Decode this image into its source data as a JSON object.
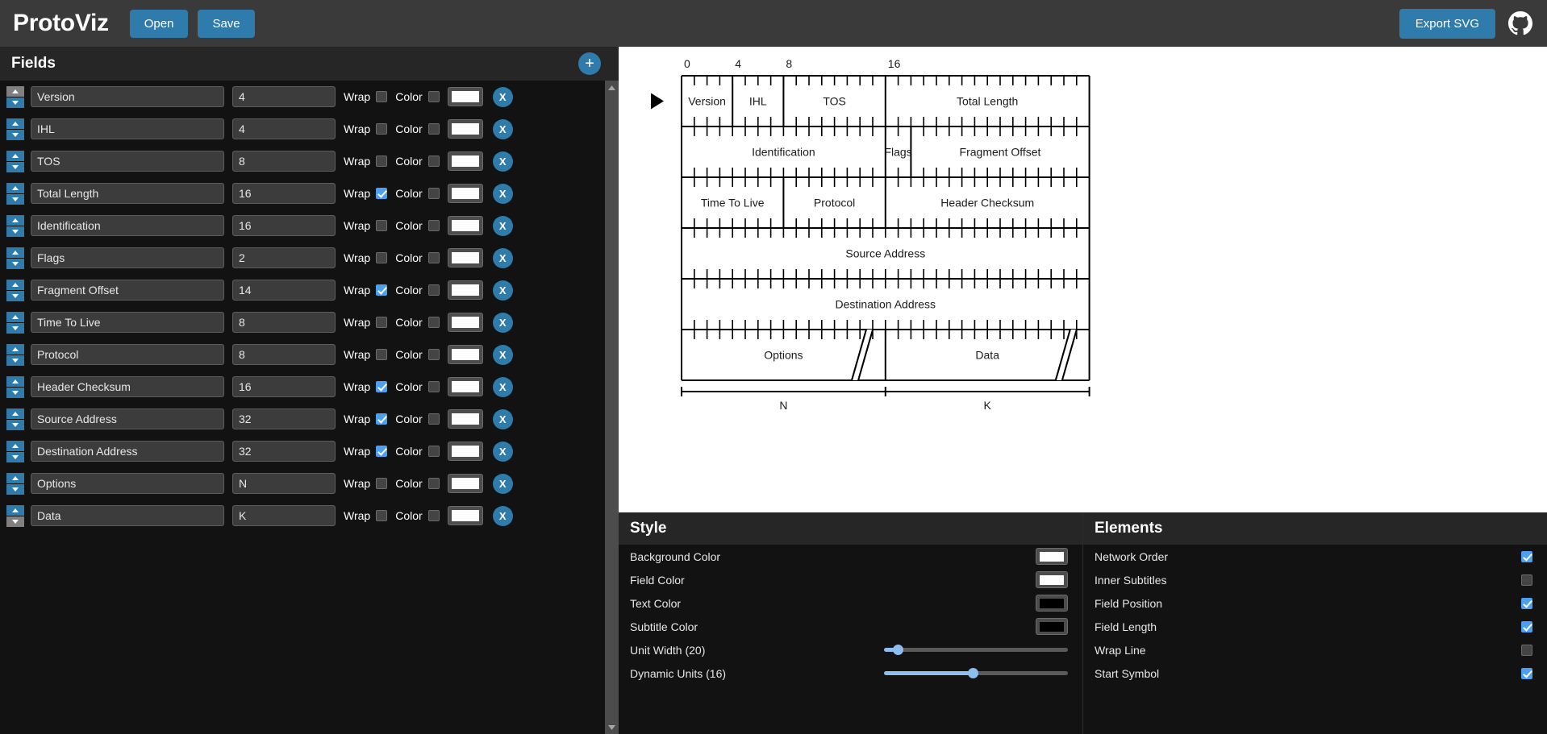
{
  "app": {
    "title": "ProtoViz",
    "open_label": "Open",
    "save_label": "Save",
    "export_label": "Export SVG",
    "github_icon": "github-icon"
  },
  "fields_panel": {
    "title": "Fields",
    "add_label": "+",
    "wrap_label": "Wrap",
    "color_label": "Color",
    "delete_label": "X",
    "rows": [
      {
        "name": "Version",
        "size": "4",
        "wrap": false,
        "color": false,
        "swatch": "#ffffff"
      },
      {
        "name": "IHL",
        "size": "4",
        "wrap": false,
        "color": false,
        "swatch": "#ffffff"
      },
      {
        "name": "TOS",
        "size": "8",
        "wrap": false,
        "color": false,
        "swatch": "#ffffff"
      },
      {
        "name": "Total Length",
        "size": "16",
        "wrap": true,
        "color": false,
        "swatch": "#ffffff"
      },
      {
        "name": "Identification",
        "size": "16",
        "wrap": false,
        "color": false,
        "swatch": "#ffffff"
      },
      {
        "name": "Flags",
        "size": "2",
        "wrap": false,
        "color": false,
        "swatch": "#ffffff"
      },
      {
        "name": "Fragment Offset",
        "size": "14",
        "wrap": true,
        "color": false,
        "swatch": "#ffffff"
      },
      {
        "name": "Time To Live",
        "size": "8",
        "wrap": false,
        "color": false,
        "swatch": "#ffffff"
      },
      {
        "name": "Protocol",
        "size": "8",
        "wrap": false,
        "color": false,
        "swatch": "#ffffff"
      },
      {
        "name": "Header Checksum",
        "size": "16",
        "wrap": true,
        "color": false,
        "swatch": "#ffffff"
      },
      {
        "name": "Source Address",
        "size": "32",
        "wrap": true,
        "color": false,
        "swatch": "#ffffff"
      },
      {
        "name": "Destination Address",
        "size": "32",
        "wrap": true,
        "color": false,
        "swatch": "#ffffff"
      },
      {
        "name": "Options",
        "size": "N",
        "wrap": false,
        "color": false,
        "swatch": "#ffffff"
      },
      {
        "name": "Data",
        "size": "K",
        "wrap": false,
        "color": false,
        "swatch": "#ffffff"
      }
    ]
  },
  "style_panel": {
    "title": "Style",
    "options": [
      {
        "label": "Background Color",
        "type": "color",
        "value": "#ffffff"
      },
      {
        "label": "Field Color",
        "type": "color",
        "value": "#ffffff"
      },
      {
        "label": "Text Color",
        "type": "color",
        "value": "#000000"
      },
      {
        "label": "Subtitle Color",
        "type": "color",
        "value": "#000000"
      },
      {
        "label": "Unit Width (20)",
        "type": "slider",
        "value": 20,
        "min": 10,
        "max": 200
      },
      {
        "label": "Dynamic Units (16)",
        "type": "slider",
        "value": 16,
        "min": 1,
        "max": 32
      }
    ]
  },
  "elements_panel": {
    "title": "Elements",
    "options": [
      {
        "label": "Network Order",
        "checked": true
      },
      {
        "label": "Inner Subtitles",
        "checked": false
      },
      {
        "label": "Field Position",
        "checked": true
      },
      {
        "label": "Field Length",
        "checked": true
      },
      {
        "label": "Wrap Line",
        "checked": false
      },
      {
        "label": "Start Symbol",
        "checked": true
      }
    ]
  },
  "diagram": {
    "ruler_labels": [
      "0",
      "4",
      "8",
      "16"
    ],
    "ruler_positions": [
      0,
      4,
      8,
      16
    ],
    "bits_per_row": 32,
    "start_symbol": true,
    "rows": [
      {
        "cells": [
          {
            "label": "Version",
            "bits": 4
          },
          {
            "label": "IHL",
            "bits": 4
          },
          {
            "label": "TOS",
            "bits": 8
          },
          {
            "label": "Total Length",
            "bits": 16
          }
        ]
      },
      {
        "cells": [
          {
            "label": "Identification",
            "bits": 16
          },
          {
            "label": "Flags",
            "bits": 2
          },
          {
            "label": "Fragment Offset",
            "bits": 14
          }
        ]
      },
      {
        "cells": [
          {
            "label": "Time To Live",
            "bits": 8
          },
          {
            "label": "Protocol",
            "bits": 8
          },
          {
            "label": "Header Checksum",
            "bits": 16
          }
        ]
      },
      {
        "cells": [
          {
            "label": "Source Address",
            "bits": 32
          }
        ]
      },
      {
        "cells": [
          {
            "label": "Destination Address",
            "bits": 32
          }
        ]
      },
      {
        "cells": [
          {
            "label": "Options",
            "bits": 16,
            "dynamic": true
          },
          {
            "label": "Data",
            "bits": 16,
            "dynamic": true
          }
        ]
      }
    ],
    "measures": [
      {
        "label": "N",
        "bits": 16
      },
      {
        "label": "K",
        "bits": 16
      }
    ]
  }
}
